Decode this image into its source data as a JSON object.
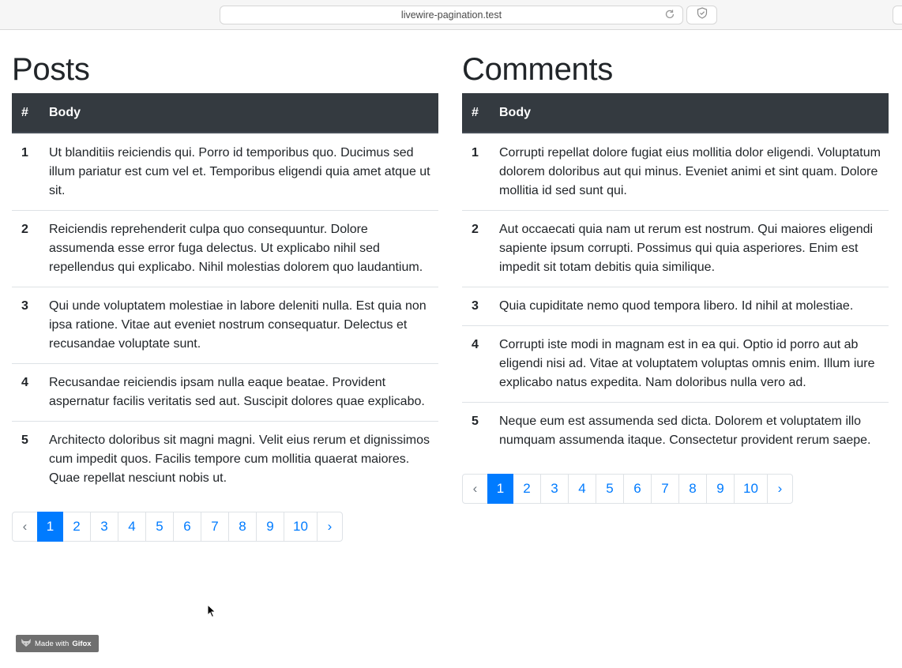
{
  "browser": {
    "url": "livewire-pagination.test"
  },
  "posts": {
    "title": "Posts",
    "headers": {
      "num": "#",
      "body": "Body"
    },
    "rows": [
      {
        "num": "1",
        "body": "Ut blanditiis reiciendis qui. Porro id temporibus quo. Ducimus sed illum pariatur est cum vel et. Temporibus eligendi quia amet atque ut sit."
      },
      {
        "num": "2",
        "body": "Reiciendis reprehenderit culpa quo consequuntur. Dolore assumenda esse error fuga delectus. Ut explicabo nihil sed repellendus qui explicabo. Nihil molestias dolorem quo laudantium."
      },
      {
        "num": "3",
        "body": "Qui unde voluptatem molestiae in labore deleniti nulla. Est quia non ipsa ratione. Vitae aut eveniet nostrum consequatur. Delectus et recusandae voluptate sunt."
      },
      {
        "num": "4",
        "body": "Recusandae reiciendis ipsam nulla eaque beatae. Provident aspernatur facilis veritatis sed aut. Suscipit dolores quae explicabo."
      },
      {
        "num": "5",
        "body": "Architecto doloribus sit magni magni. Velit eius rerum et dignissimos cum impedit quos. Facilis tempore cum mollitia quaerat maiores. Quae repellat nesciunt nobis ut."
      }
    ],
    "pagination": {
      "prev": "‹",
      "next": "›",
      "pages": [
        "1",
        "2",
        "3",
        "4",
        "5",
        "6",
        "7",
        "8",
        "9",
        "10"
      ],
      "active": "1"
    }
  },
  "comments": {
    "title": "Comments",
    "headers": {
      "num": "#",
      "body": "Body"
    },
    "rows": [
      {
        "num": "1",
        "body": "Corrupti repellat dolore fugiat eius mollitia dolor eligendi. Voluptatum dolorem doloribus aut qui minus. Eveniet animi et sint quam. Dolore mollitia id sed sunt qui."
      },
      {
        "num": "2",
        "body": "Aut occaecati quia nam ut rerum est nostrum. Qui maiores eligendi sapiente ipsum corrupti. Possimus qui quia asperiores. Enim est impedit sit totam debitis quia similique."
      },
      {
        "num": "3",
        "body": "Quia cupiditate nemo quod tempora libero. Id nihil at molestiae."
      },
      {
        "num": "4",
        "body": "Corrupti iste modi in magnam est in ea qui. Optio id porro aut ab eligendi nisi ad. Vitae at voluptatem voluptas omnis enim. Illum iure explicabo natus expedita. Nam doloribus nulla vero ad."
      },
      {
        "num": "5",
        "body": "Neque eum est assumenda sed dicta. Dolorem et voluptatem illo numquam assumenda itaque. Consectetur provident rerum saepe."
      }
    ],
    "pagination": {
      "prev": "‹",
      "next": "›",
      "pages": [
        "1",
        "2",
        "3",
        "4",
        "5",
        "6",
        "7",
        "8",
        "9",
        "10"
      ],
      "active": "1"
    }
  },
  "badge": {
    "made_with": "Made with",
    "brand": "Gifox"
  },
  "colors": {
    "accent": "#007bff",
    "header_bg": "#343a40",
    "border": "#dee2e6"
  }
}
